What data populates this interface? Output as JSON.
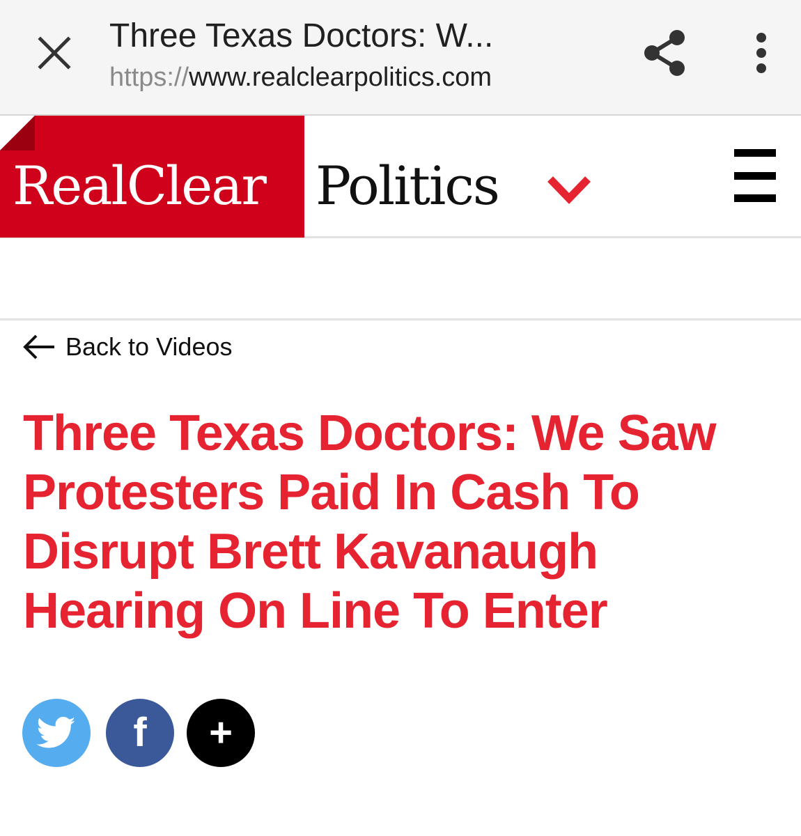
{
  "browser": {
    "title": "Three Texas Doctors: W...",
    "url_scheme": "https://",
    "url_host": "www.realclearpolitics.com"
  },
  "site": {
    "logo_part1": "RealClear",
    "logo_part2": "Politics"
  },
  "nav": {
    "back_label": "Back to Videos"
  },
  "article": {
    "headline": "Three Texas Doctors: We Saw Protesters Paid In Cash To Disrupt Brett Kavanaugh Hearing On Line To Enter"
  },
  "share": {
    "facebook_glyph": "f",
    "more_glyph": "+"
  },
  "colors": {
    "brand_red": "#d0021b",
    "headline_red": "#e62330",
    "twitter_blue": "#55acee",
    "facebook_blue": "#3b5998"
  },
  "icons": {
    "close": "close-icon",
    "share": "share-icon",
    "more": "more-vertical-icon",
    "section": "chevron-down-icon",
    "menu": "hamburger-menu-icon",
    "back": "arrow-left-icon",
    "twitter": "twitter-bird-icon",
    "facebook": "facebook-icon",
    "plus": "plus-icon"
  }
}
